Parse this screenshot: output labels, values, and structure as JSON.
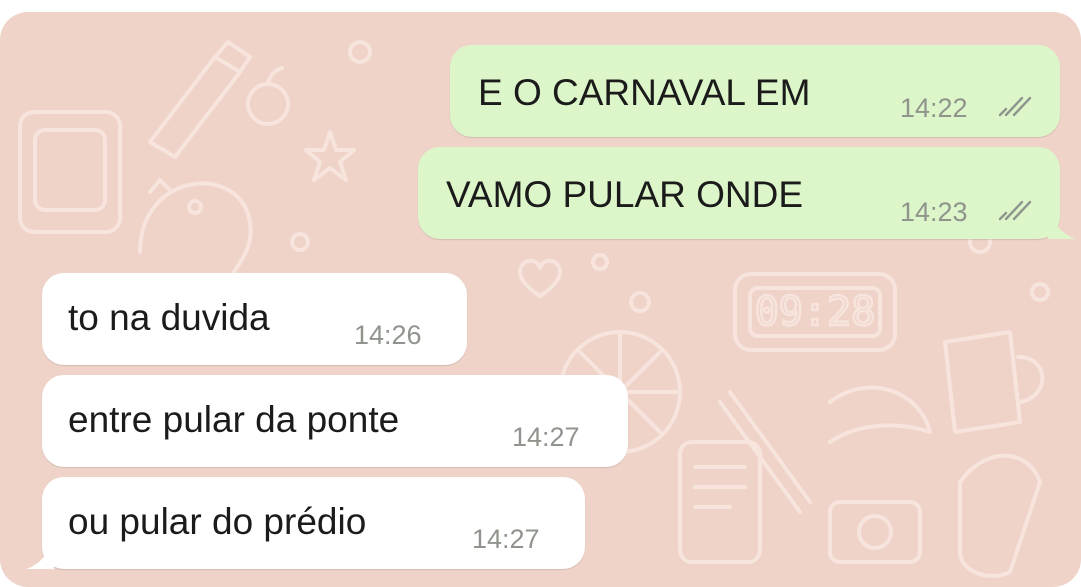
{
  "wallpaper": {
    "color": "#efd3c9",
    "doodle_color": "#f6e4dd",
    "clock_doodle_text": "09:28"
  },
  "colors": {
    "outgoing_bubble": "#ddf6c9",
    "incoming_bubble": "#ffffff",
    "timestamp": "#8f948c",
    "read_ticks": "#8f948c"
  },
  "messages": [
    {
      "direction": "outgoing",
      "text": "E O CARNAVAL EM",
      "time": "14:22",
      "status": "delivered-ticks"
    },
    {
      "direction": "outgoing",
      "text": "VAMO PULAR ONDE",
      "time": "14:23",
      "status": "delivered-ticks"
    },
    {
      "direction": "incoming",
      "text": "to na duvida",
      "time": "14:26"
    },
    {
      "direction": "incoming",
      "text": "entre pular da ponte",
      "time": "14:27"
    },
    {
      "direction": "incoming",
      "text": "ou pular do prédio",
      "time": "14:27"
    }
  ]
}
